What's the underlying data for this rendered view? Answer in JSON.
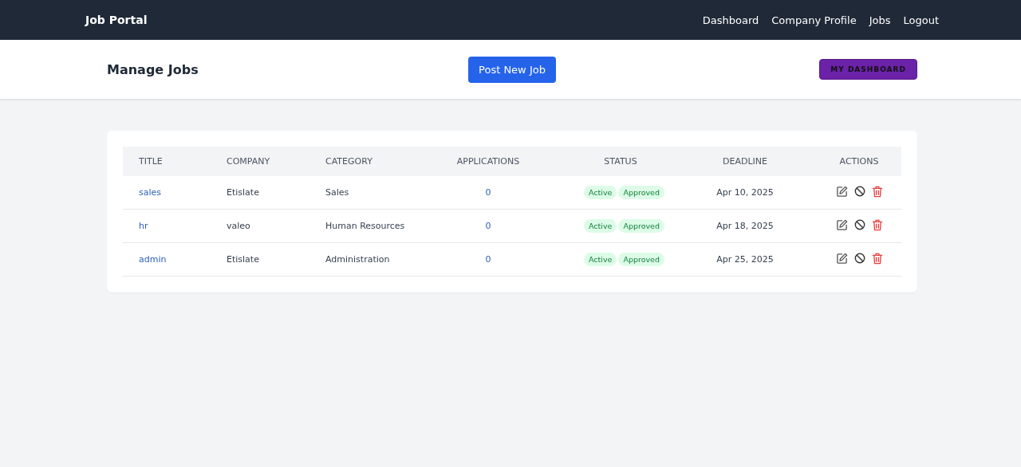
{
  "navbar": {
    "brand": "Job Portal",
    "links": [
      "Dashboard",
      "Company Profile",
      "Jobs",
      "Logout"
    ]
  },
  "header": {
    "title": "Manage Jobs",
    "post_button": "Post New Job",
    "dashboard_button": "MY DASHBOARD"
  },
  "table": {
    "columns": [
      "TITLE",
      "COMPANY",
      "CATEGORY",
      "APPLICATIONS",
      "STATUS",
      "DEADLINE",
      "ACTIONS"
    ],
    "rows": [
      {
        "title": "sales",
        "company": "Etislate",
        "category": "Sales",
        "applications": "0",
        "badges": [
          "Active",
          "Approved"
        ],
        "deadline": "Apr 10, 2025"
      },
      {
        "title": "hr",
        "company": "valeo",
        "category": "Human Resources",
        "applications": "0",
        "badges": [
          "Active",
          "Approved"
        ],
        "deadline": "Apr 18, 2025"
      },
      {
        "title": "admin",
        "company": "Etislate",
        "category": "Administration",
        "applications": "0",
        "badges": [
          "Active",
          "Approved"
        ],
        "deadline": "Apr 25, 2025"
      }
    ]
  }
}
